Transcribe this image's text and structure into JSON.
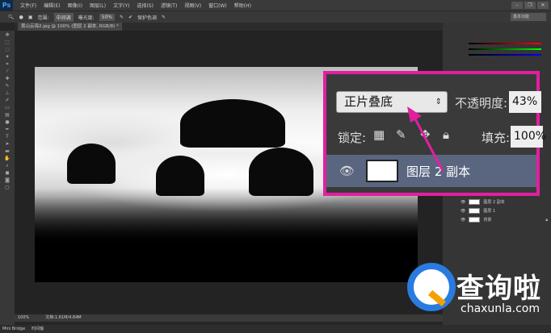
{
  "app": {
    "logo": "Ps",
    "menu": [
      "文件(F)",
      "编辑(E)",
      "图像(I)",
      "图层(L)",
      "文字(Y)",
      "选择(S)",
      "滤镜(T)",
      "视图(V)",
      "窗口(W)",
      "帮助(H)"
    ],
    "window_controls": [
      "–",
      "❐",
      "✕"
    ]
  },
  "options": {
    "range_label": "范围:",
    "range_value": "中间调",
    "exposure_label": "曝光度:",
    "exposure_value": "50%",
    "protect_label": "保护色调",
    "protect_checked": true
  },
  "workspace": "基本功能",
  "document_tab": "黄山云海2.jpg @ 100% (图层 2 副本, RGB/8) *",
  "status": {
    "zoom": "100%",
    "doc": "文档:1.61M/4.84M"
  },
  "bottom_tabs": [
    "Mini Bridge",
    "时间轴"
  ],
  "layers_panel": {
    "layers": [
      {
        "name": "图层 2 副本"
      },
      {
        "name": "图层 1"
      },
      {
        "name": "背景",
        "locked": true
      }
    ]
  },
  "inset": {
    "blend_mode": "正片叠底",
    "opacity_label": "不透明度:",
    "opacity_value": "43%",
    "lock_label": "锁定:",
    "fill_label": "填充:",
    "fill_value": "100%",
    "layer_name": "图层 2 副本"
  },
  "watermark": {
    "title": "查询啦",
    "url": "chaxunla.com"
  },
  "colors": {
    "highlight": "#e020a0",
    "selected_layer": "#5a6680"
  }
}
